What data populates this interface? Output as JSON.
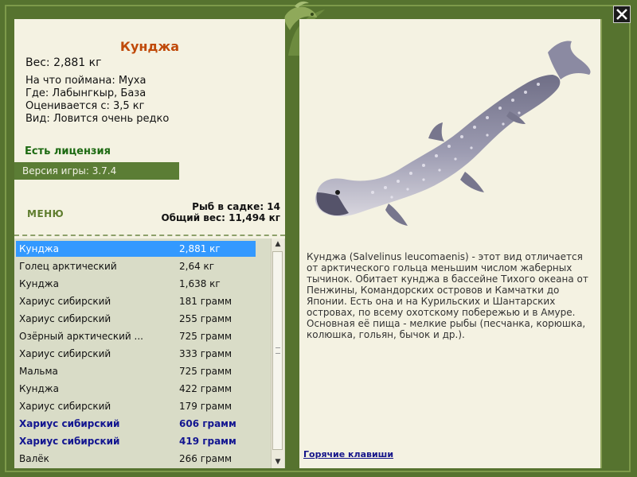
{
  "fish": {
    "title": "Кунджа",
    "weight": "Вес: 2,881 кг",
    "info": [
      "На что поймана: Муха",
      "Где: Лабынгкыр, База",
      "Оценивается с: 3,5 кг",
      "Вид: Ловится очень редко"
    ]
  },
  "license": "Есть лицензия",
  "version": "Версия игры: 3.7.4",
  "menu_label": "МЕНЮ",
  "stats": {
    "count": "Рыб в садке: 14",
    "total": "Общий вес: 11,494 кг"
  },
  "catch_list": [
    {
      "name": "Кунджа",
      "weight": "2,881 кг"
    },
    {
      "name": "Голец арктический",
      "weight": "2,64 кг"
    },
    {
      "name": "Кунджа",
      "weight": "1,638 кг"
    },
    {
      "name": "Хариус сибирский",
      "weight": "181 грамм"
    },
    {
      "name": "Хариус сибирский",
      "weight": "255 грамм"
    },
    {
      "name": "Озёрный арктический ...",
      "weight": "725 грамм"
    },
    {
      "name": "Хариус сибирский",
      "weight": "333 грамм"
    },
    {
      "name": "Мальма",
      "weight": "725 грамм"
    },
    {
      "name": "Кунджа",
      "weight": "422 грамм"
    },
    {
      "name": "Хариус сибирский",
      "weight": "179 грамм"
    },
    {
      "name": "Хариус сибирский",
      "weight": "606 грамм"
    },
    {
      "name": "Хариус сибирский",
      "weight": "419 грамм"
    },
    {
      "name": "Валёк",
      "weight": "266 грамм"
    }
  ],
  "description": "Кунджа (Salvelinus leucomaenis) - этот вид отличается от арктического гольца меньшим числом жаберных тычинок. Обитает кунджа в бассейне Тихого океана от Пенжины, Командорских островов и Камчатки до Японии. Есть она и на Курильских и Шантарских островах, по всему охотскому побережью и в Амуре. Основная её пища - мелкие рыбы (песчанка, корюшка, колюшка, гольян, бычок и др.).",
  "hotkeys": "Горячие клавиши",
  "icons": {
    "close": "close-icon",
    "logo": "fish-logo-icon",
    "fish_image": "char-fish-illustration"
  },
  "colors": {
    "frame": "#56732f",
    "panel": "#f4f2e2",
    "title": "#c04a0a",
    "license": "#1d6a12",
    "selected": "#3399ff",
    "bold_row": "#121590"
  }
}
